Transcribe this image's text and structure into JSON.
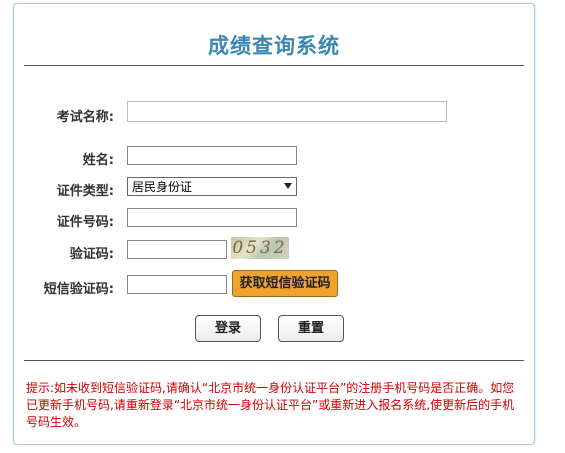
{
  "title": "成绩查询系统",
  "form": {
    "exam_name_label": "考试名称:",
    "exam_name_value": "",
    "name_label": "姓名:",
    "name_value": "",
    "id_type_label": "证件类型:",
    "id_type_selected": "居民身份证",
    "id_number_label": "证件号码:",
    "id_number_value": "",
    "captcha_label": "验证码:",
    "captcha_value": "",
    "captcha_image_text": "0532",
    "sms_label": "短信验证码:",
    "sms_value": "",
    "sms_button": "获取短信验证码"
  },
  "actions": {
    "login": "登录",
    "reset": "重置"
  },
  "notice": "提示:如未收到短信验证码,请确认“北京市统一身份认证平台”的注册手机号码是否正确。如您已更新手机号码,请重新登录“北京市统一身份认证平台”或重新进入报名系统,使更新后的手机号码生效。",
  "colors": {
    "title": "#3c86b6",
    "sms_button_bg": "#f0a22e",
    "notice_text": "#cc0000"
  }
}
